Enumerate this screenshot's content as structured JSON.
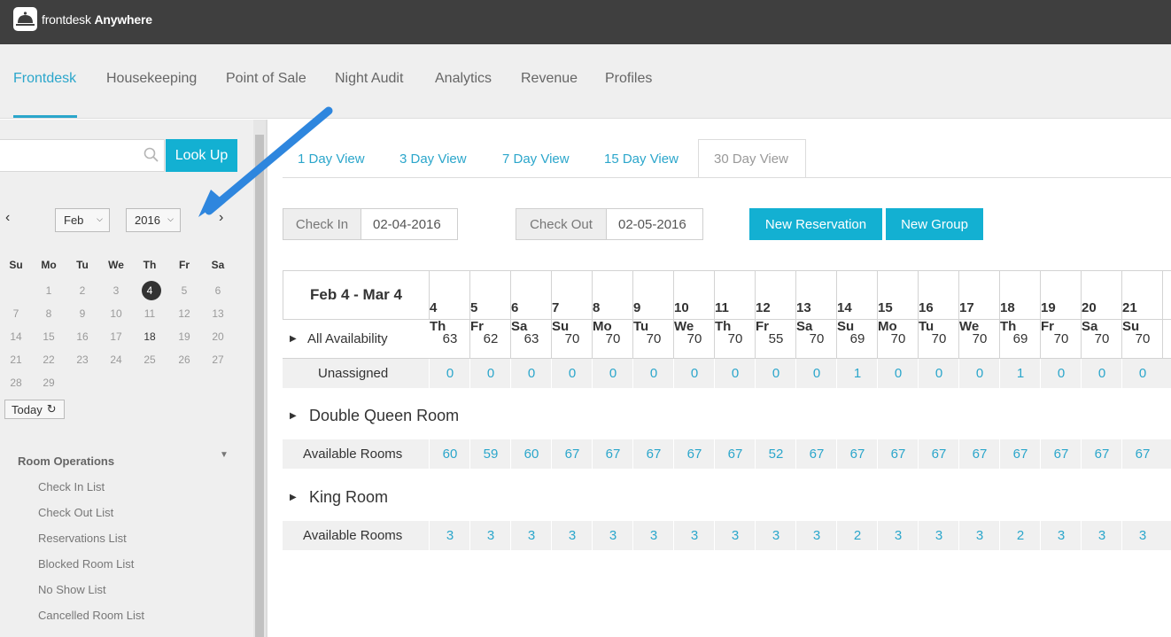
{
  "app": {
    "brand_plain": "frontdesk",
    "brand_bold": "Anywhere"
  },
  "nav": {
    "items": [
      {
        "label": "Frontdesk",
        "active": true
      },
      {
        "label": "Housekeeping"
      },
      {
        "label": "Point of Sale"
      },
      {
        "label": "Night Audit"
      },
      {
        "label": "Analytics"
      },
      {
        "label": "Revenue"
      },
      {
        "label": "Profiles"
      }
    ]
  },
  "sidebar": {
    "search": {
      "placeholder": "",
      "button": "Look Up"
    },
    "calendar": {
      "month": "Feb",
      "year": "2016",
      "weekdays": [
        "Su",
        "Mo",
        "Tu",
        "We",
        "Th",
        "Fr",
        "Sa"
      ],
      "weeks": [
        [
          "",
          "1",
          "2",
          "3",
          "4",
          "5",
          "6"
        ],
        [
          "7",
          "8",
          "9",
          "10",
          "11",
          "12",
          "13"
        ],
        [
          "14",
          "15",
          "16",
          "17",
          "18",
          "19",
          "20"
        ],
        [
          "21",
          "22",
          "23",
          "24",
          "25",
          "26",
          "27"
        ],
        [
          "28",
          "29",
          "",
          "",
          "",
          "",
          ""
        ]
      ],
      "selected": "4",
      "today_label": "Today"
    },
    "room_operations": {
      "title": "Room Operations",
      "items": [
        "Check In List",
        "Check Out List",
        "Reservations List",
        "Blocked Room List",
        "No Show List",
        "Cancelled Room List"
      ]
    }
  },
  "views": {
    "tabs": [
      "1 Day View",
      "3 Day View",
      "7 Day View",
      "15 Day View",
      "30 Day View"
    ],
    "active": "30 Day View"
  },
  "form": {
    "check_in_label": "Check In",
    "check_in_value": "02-04-2016",
    "check_out_label": "Check Out",
    "check_out_value": "02-05-2016",
    "new_reservation": "New Reservation",
    "new_group": "New Group"
  },
  "grid": {
    "range": "Feb 4 - Mar 4",
    "days": [
      {
        "d": "4",
        "w": "Th"
      },
      {
        "d": "5",
        "w": "Fr"
      },
      {
        "d": "6",
        "w": "Sa"
      },
      {
        "d": "7",
        "w": "Su"
      },
      {
        "d": "8",
        "w": "Mo"
      },
      {
        "d": "9",
        "w": "Tu"
      },
      {
        "d": "10",
        "w": "We"
      },
      {
        "d": "11",
        "w": "Th"
      },
      {
        "d": "12",
        "w": "Fr"
      },
      {
        "d": "13",
        "w": "Sa"
      },
      {
        "d": "14",
        "w": "Su"
      },
      {
        "d": "15",
        "w": "Mo"
      },
      {
        "d": "16",
        "w": "Tu"
      },
      {
        "d": "17",
        "w": "We"
      },
      {
        "d": "18",
        "w": "Th"
      },
      {
        "d": "19",
        "w": "Fr"
      },
      {
        "d": "20",
        "w": "Sa"
      },
      {
        "d": "21",
        "w": "Su"
      }
    ],
    "all_availability": {
      "label": "All Availability",
      "values": [
        "63",
        "62",
        "63",
        "70",
        "70",
        "70",
        "70",
        "70",
        "55",
        "70",
        "69",
        "70",
        "70",
        "70",
        "69",
        "70",
        "70",
        "70"
      ]
    },
    "unassigned": {
      "label": "Unassigned",
      "values": [
        "0",
        "0",
        "0",
        "0",
        "0",
        "0",
        "0",
        "0",
        "0",
        "0",
        "1",
        "0",
        "0",
        "0",
        "1",
        "0",
        "0",
        "0"
      ]
    },
    "room_types": [
      {
        "name": "Double Queen Room",
        "row_label": "Available Rooms",
        "values": [
          "60",
          "59",
          "60",
          "67",
          "67",
          "67",
          "67",
          "67",
          "52",
          "67",
          "67",
          "67",
          "67",
          "67",
          "67",
          "67",
          "67",
          "67"
        ]
      },
      {
        "name": "King Room",
        "row_label": "Available Rooms",
        "values": [
          "3",
          "3",
          "3",
          "3",
          "3",
          "3",
          "3",
          "3",
          "3",
          "3",
          "2",
          "3",
          "3",
          "3",
          "2",
          "3",
          "3",
          "3"
        ]
      }
    ]
  },
  "colors": {
    "accent": "#13b0d2",
    "link": "#2ba6cb",
    "topbar": "#3f3f3f",
    "annotation_arrow": "#2e86de"
  }
}
